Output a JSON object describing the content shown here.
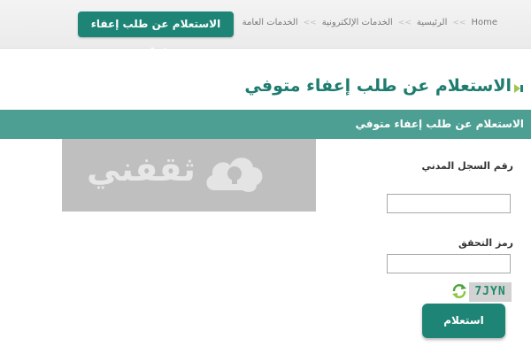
{
  "header": {
    "breadcrumb": [
      "Home",
      "الرئيسية",
      "الخدمات الإلكترونية",
      "الخدمات العامة"
    ],
    "breadcrumb_separator": ">>",
    "action_button": "الاستعلام عن طلب إعفاء متوفي"
  },
  "page": {
    "title": "الاستعلام عن طلب إعفاء متوفي",
    "banner": "الاستعلام عن طلب إعفاء متوفي",
    "watermark_text": "ثقفني"
  },
  "form": {
    "civil_record_label": "رقم السجل المدني",
    "civil_record_value": "",
    "verification_label": "رمز التحقق",
    "verification_value": "",
    "captcha_text": "7JYN",
    "submit_label": "استعلام"
  },
  "colors": {
    "primary": "#1e8576",
    "banner": "#4e9f93",
    "title": "#1e7c6f",
    "watermark_bg": "#bfbfbf"
  },
  "icons": [
    "title-arrow-icon",
    "lightbulb-cloud-icon",
    "refresh-icon"
  ]
}
